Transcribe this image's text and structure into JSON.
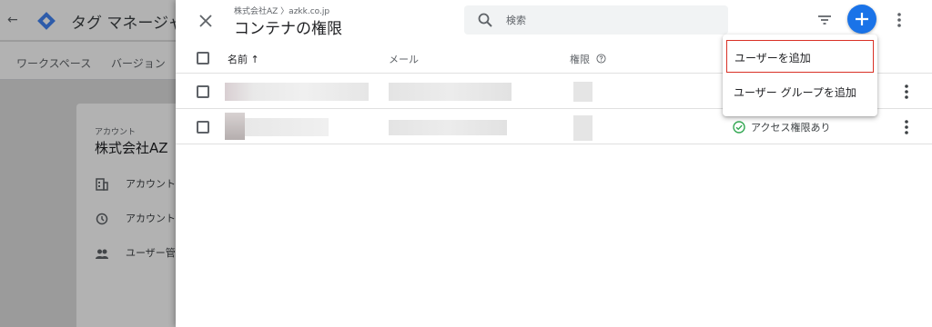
{
  "background": {
    "back_icon": "arrow-left-icon",
    "app_title": "タグ マネージャー",
    "subnav": [
      "ワークスペース",
      "バージョン"
    ],
    "account_label": "アカウント",
    "account_name": "株式会社AZ",
    "sidebar": [
      {
        "icon": "building-icon",
        "label": "アカウント"
      },
      {
        "icon": "history-icon",
        "label": "アカウント"
      },
      {
        "icon": "people-icon",
        "label": "ユーザー管"
      }
    ]
  },
  "panel": {
    "breadcrumb": "株式会社AZ 〉azkk.co.jp",
    "title": "コンテナの権限",
    "search": {
      "placeholder": "検索",
      "value": ""
    },
    "columns": {
      "name": "名前 ↑",
      "email": "メール",
      "permission": "権限"
    },
    "rows": [
      {
        "status": ""
      },
      {
        "status": "アクセス権限あり"
      }
    ]
  },
  "menu": {
    "items": [
      "ユーザーを追加",
      "ユーザー グループを追加"
    ]
  },
  "colors": {
    "accent": "#1a73e8",
    "highlight_border": "#d93025",
    "status_ok": "#34a853"
  }
}
